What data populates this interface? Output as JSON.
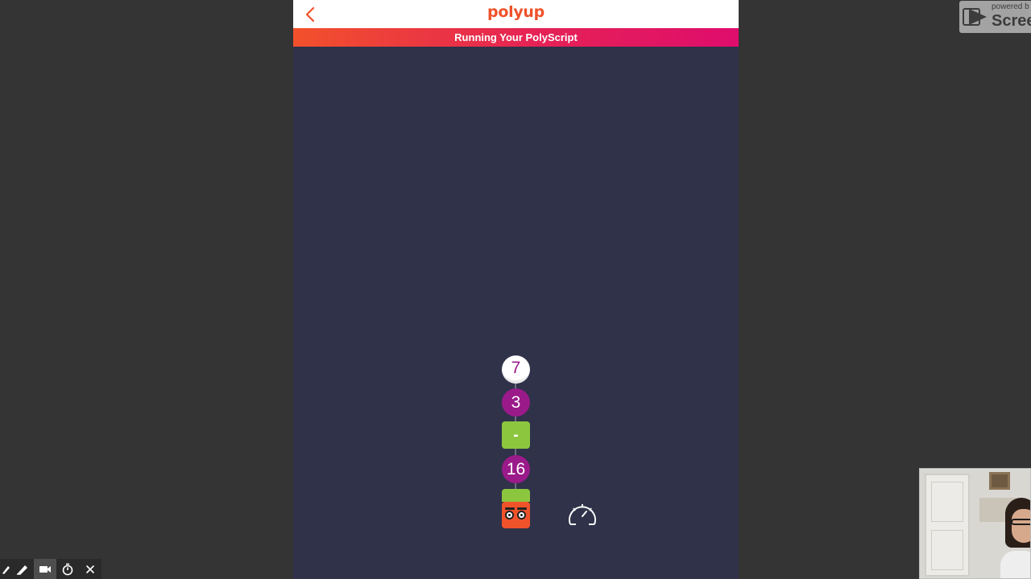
{
  "header": {
    "logo": "polyup",
    "back_icon": "chevron-left-icon"
  },
  "banner": {
    "title": "Running Your PolyScript"
  },
  "program_stack": {
    "nodes": [
      {
        "kind": "number-white",
        "value": "7"
      },
      {
        "kind": "number-purple",
        "value": "3"
      },
      {
        "kind": "operator",
        "value": "-"
      },
      {
        "kind": "number-purple",
        "value": "16"
      },
      {
        "kind": "operator-partial",
        "value": ""
      },
      {
        "kind": "robot",
        "value": ""
      }
    ]
  },
  "controls": {
    "speed_icon": "speedometer-icon"
  },
  "watermark": {
    "line1": "powered b",
    "line2": "Screen"
  },
  "recorder_toolbar": {
    "icons": [
      "pencil-icon",
      "marker-icon",
      "camera-icon",
      "timer-icon",
      "close-icon"
    ]
  },
  "colors": {
    "brand_orange": "#f0522a",
    "brand_pink": "#df0d6d",
    "canvas": "#2f3249",
    "purple_node": "#9a1a8a",
    "green_node": "#8cc63f"
  }
}
